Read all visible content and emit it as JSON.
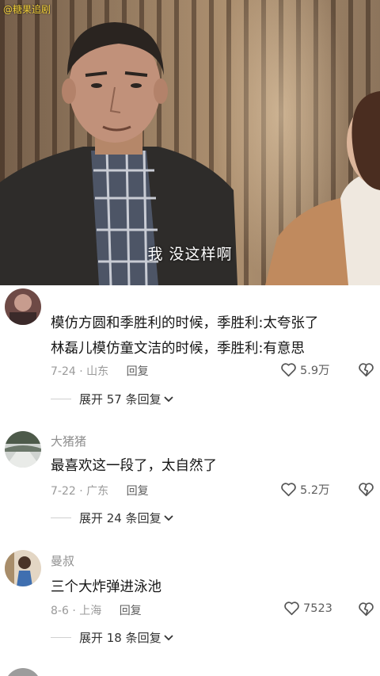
{
  "video": {
    "watermark": "@糖果追剧",
    "subtitle": "我 没这样啊"
  },
  "comments": [
    {
      "username": "",
      "lines": [
        "模仿方圆和季胜利的时候，季胜利:太夸张了",
        "林磊儿模仿童文洁的时候，季胜利:有意思"
      ],
      "date": "7-24",
      "location": "山东",
      "reply_label": "回复",
      "likes": "5.9万",
      "expand_label": "展开 57 条回复"
    },
    {
      "username": "大猪猪",
      "lines": [
        "最喜欢这一段了，太自然了"
      ],
      "date": "7-22",
      "location": "广东",
      "reply_label": "回复",
      "likes": "5.2万",
      "expand_label": "展开 24 条回复"
    },
    {
      "username": "曼叔",
      "lines": [
        "三个大炸弹进泳池"
      ],
      "date": "8-6",
      "location": "上海",
      "reply_label": "回复",
      "likes": "7523",
      "expand_label": "展开 18 条回复"
    }
  ],
  "icons": {
    "like": "heart-outline-icon",
    "dislike": "broken-heart-icon",
    "expand": "chevron-down-icon"
  },
  "colors": {
    "watermark": "#f4d23b",
    "text": "#151515",
    "secondary": "#9a9a9a"
  }
}
